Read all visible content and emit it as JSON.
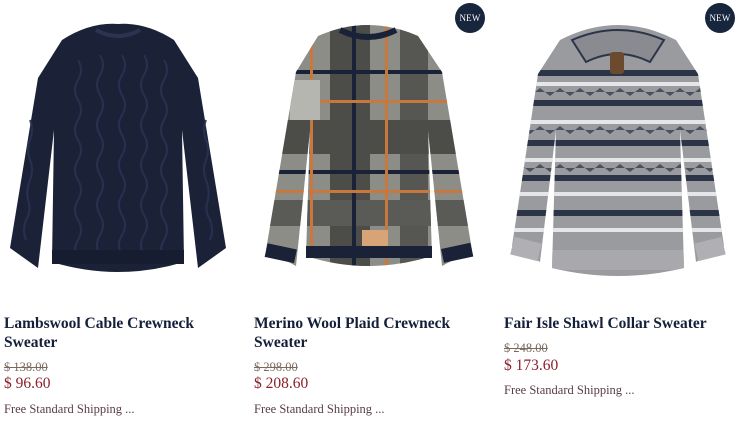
{
  "products": [
    {
      "title": "Lambswool Cable Crewneck Sweater",
      "old_price": "$ 138.00",
      "price": "$ 96.60",
      "shipping": "Free Standard Shipping ...",
      "badge": "",
      "image": "navy cable-knit crewneck sweater",
      "color": "#1b2238"
    },
    {
      "title": "Merino Wool Plaid Crewneck Sweater",
      "old_price": "$ 298.00",
      "price": "$ 208.60",
      "shipping": "Free Standard Shipping ...",
      "badge": "NEW",
      "image": "grey plaid crewneck sweater with orange and navy stripes",
      "color": "#6e6e6a"
    },
    {
      "title": "Fair Isle Shawl Collar Sweater",
      "old_price": "$ 248.00",
      "price": "$ 173.60",
      "shipping": "Free Standard Shipping ...",
      "badge": "NEW",
      "image": "grey fair isle shawl collar sweater",
      "color": "#8e8f93"
    }
  ]
}
